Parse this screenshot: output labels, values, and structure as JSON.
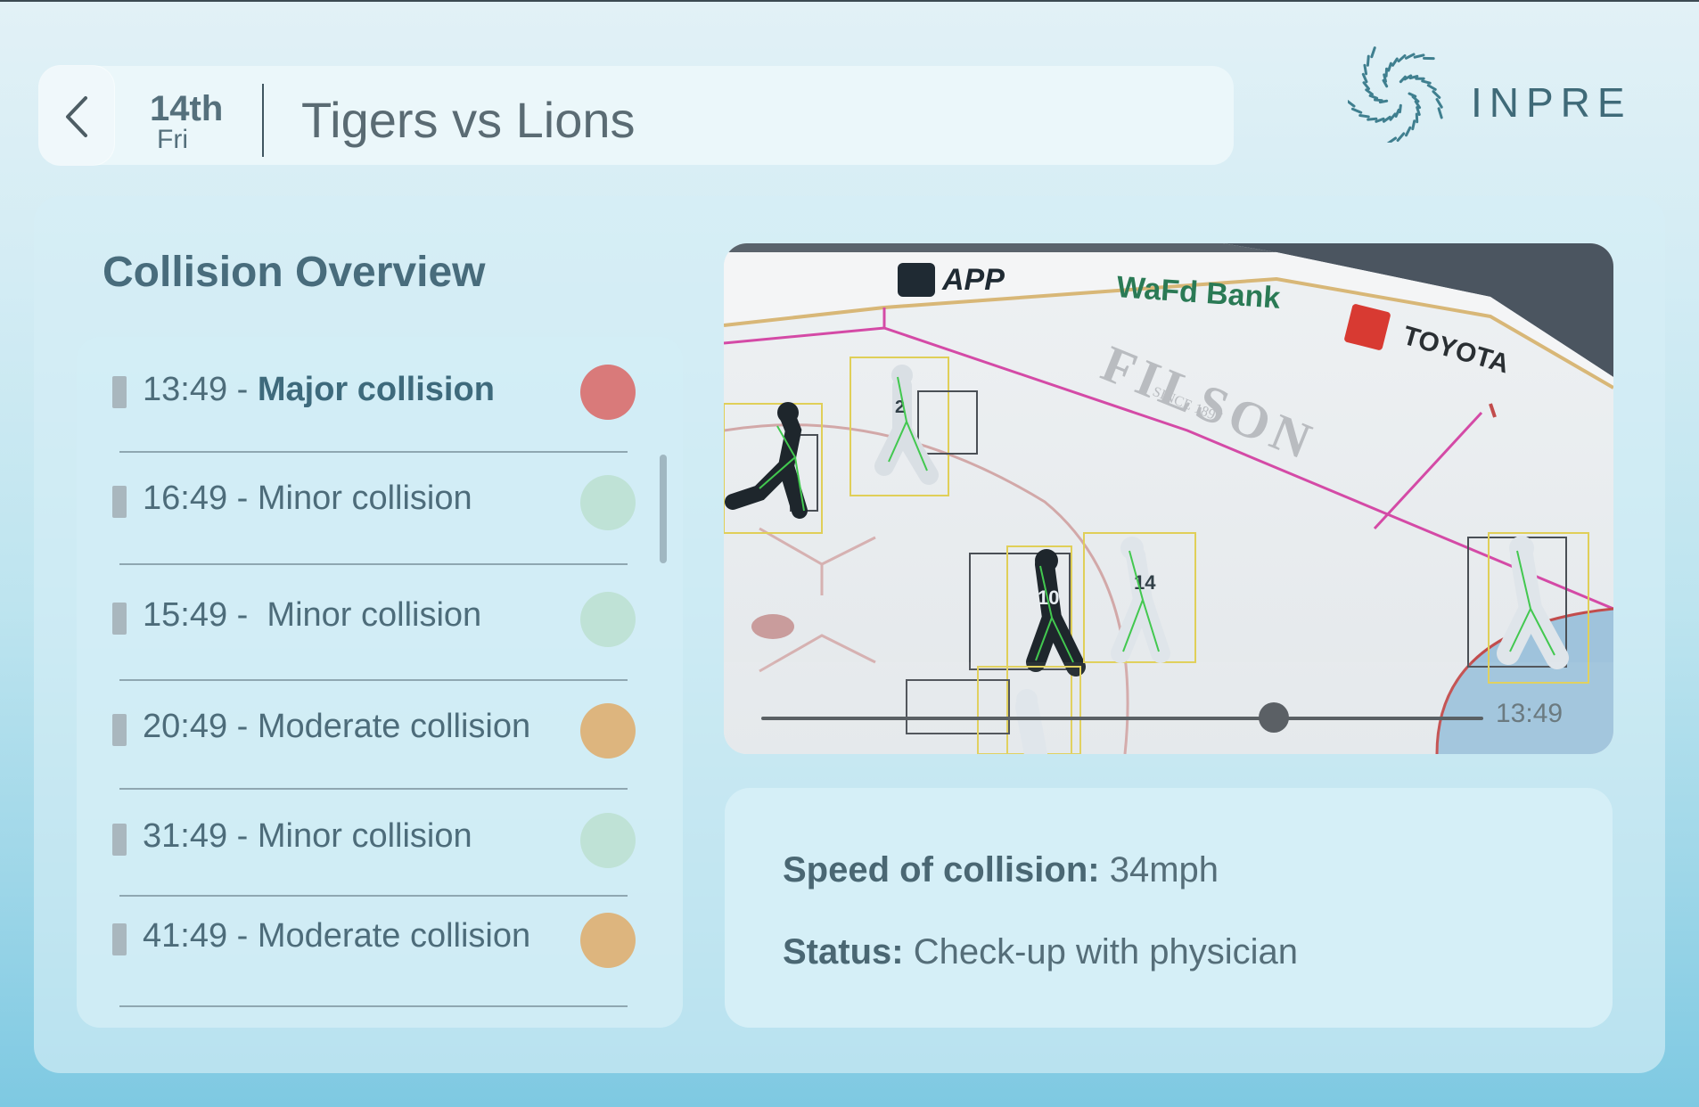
{
  "header": {
    "back_icon": "chevron-left-icon",
    "date_day": "14th",
    "date_weekday": "Fri",
    "match_title": "Tigers vs Lions"
  },
  "brand": {
    "logo_icon": "spiral-logo-icon",
    "name": "INPRE"
  },
  "overview": {
    "title": "Collision Overview",
    "items": [
      {
        "time": "13:49 - ",
        "kind": "Major collision",
        "severity": "major",
        "color": "#d97a7a"
      },
      {
        "time": "16:49 - ",
        "kind": "Minor collision",
        "severity": "minor",
        "color": "#bfe2d6"
      },
      {
        "time": "15:49 -  ",
        "kind": "Minor collision",
        "severity": "minor",
        "color": "#bfe2d6"
      },
      {
        "time": "20:49 - ",
        "kind": "Moderate collision",
        "severity": "moderate",
        "color": "#ddb57e"
      },
      {
        "time": "31:49 - ",
        "kind": "Minor collision",
        "severity": "minor",
        "color": "#bfe2d6"
      },
      {
        "time": "41:49 - ",
        "kind": "Moderate collision",
        "severity": "moderate",
        "color": "#ddb57e"
      }
    ]
  },
  "video": {
    "current_time": "13:49",
    "progress": 0.71,
    "boards": {
      "app": "APP",
      "bank": "WaFd Bank",
      "brand": "TOYOTA",
      "ice_logo": "FILSON",
      "ice_sub": "SINCE 1897"
    }
  },
  "details": {
    "speed_label": "Speed of collision:",
    "speed_value": " 34mph",
    "status_label": "Status:",
    "status_value": " Check-up with physician"
  }
}
